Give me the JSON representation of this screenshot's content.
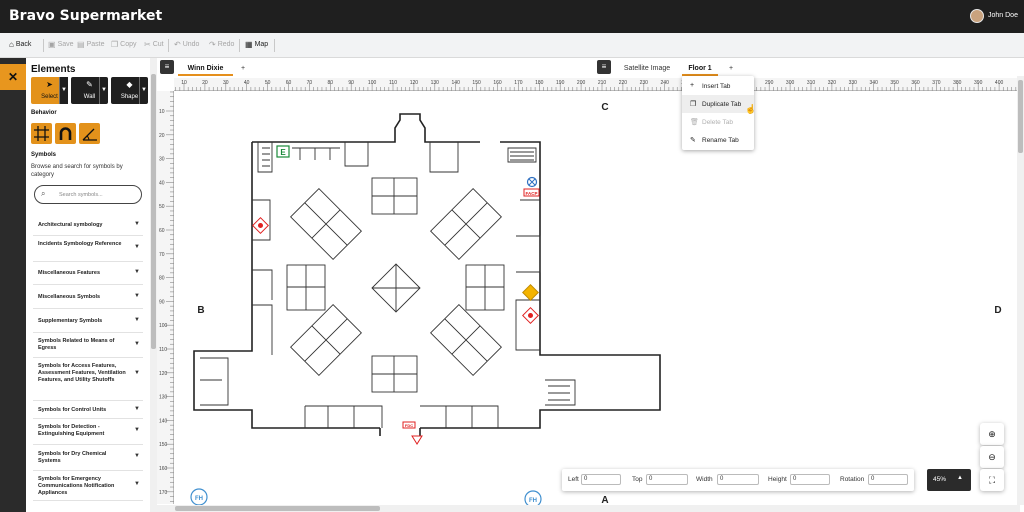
{
  "app": {
    "title": "Bravo Supermarket"
  },
  "user": {
    "name": "John Doe"
  },
  "toolbar": {
    "back": "Back",
    "save": "Save",
    "paste": "Paste",
    "copy": "Copy",
    "cut": "Cut",
    "undo": "Undo",
    "redo": "Redo",
    "map": "Map"
  },
  "elements_panel": {
    "title": "Elements",
    "tools": {
      "select": "Select",
      "wall": "Wall",
      "shape": "Shape"
    },
    "behavior_label": "Behavior",
    "symbols_label": "Symbols",
    "symbols_desc": "Browse and search for symbols by category",
    "search_placeholder": "Search symbols...",
    "categories": [
      "Architectural symbology",
      "Incidents Symbology Reference",
      "Miscellaneous Features",
      "Miscellaneous Symbols",
      "Supplementary Symbols",
      "Symbols Related to Means of Egress",
      "Symbols for Access Features, Assessment Features, Ventilation Features, and Utility Shutoffs",
      "Symbols for Control Units",
      "Symbols for Detection - Extinguishing Equipment",
      "Symbols for Dry Chemical Systems",
      "Symbols for Emergency Communications Notification Appliances"
    ]
  },
  "tabs": {
    "left": [
      "Winn Dixie"
    ],
    "right": [
      "Satellite Image",
      "Floor 1"
    ],
    "add": "+"
  },
  "context_menu": {
    "items": [
      {
        "label": "Insert Tab",
        "icon": "plus-icon",
        "disabled": false
      },
      {
        "label": "Duplicate Tab",
        "icon": "copy-icon",
        "disabled": false
      },
      {
        "label": "Delete Tab",
        "icon": "trash-icon",
        "disabled": true
      },
      {
        "label": "Rename Tab",
        "icon": "edit-icon",
        "disabled": false
      }
    ]
  },
  "ruler": {
    "top_ticks": [
      "10",
      "20",
      "30",
      "40",
      "50",
      "60",
      "70",
      "80",
      "90",
      "100",
      "110",
      "120",
      "130",
      "140",
      "150",
      "160",
      "170",
      "180",
      "190",
      "200",
      "210",
      "220",
      "230",
      "240",
      "250",
      "260",
      "270",
      "280",
      "290",
      "300",
      "310",
      "320",
      "330",
      "340",
      "350",
      "360",
      "370",
      "380",
      "390",
      "400"
    ],
    "left_ticks": [
      "10",
      "20",
      "30",
      "40",
      "50",
      "60",
      "70",
      "80",
      "90",
      "100",
      "110",
      "120",
      "130",
      "140",
      "150",
      "160",
      "170"
    ]
  },
  "canvas": {
    "side_labels": {
      "top": "C",
      "bottom": "A",
      "left": "B",
      "right": "D"
    },
    "symbols": {
      "exit": "E",
      "facp": "FACP",
      "fdc": "FDC",
      "fh": "FH"
    }
  },
  "properties": {
    "left_label": "Left",
    "left_value": "0",
    "top_label": "Top",
    "top_value": "0",
    "width_label": "Width",
    "width_value": "0",
    "height_label": "Height",
    "height_value": "0",
    "rotation_label": "Rotation",
    "rotation_value": "0"
  },
  "zoom": {
    "level": "45%"
  },
  "colors": {
    "accent": "#e3921b",
    "dark": "#1f1f1f",
    "alarm": "#e02020",
    "hazard": "#f4b400",
    "exit": "#1a8a3a",
    "fh": "#3f8fcf"
  }
}
